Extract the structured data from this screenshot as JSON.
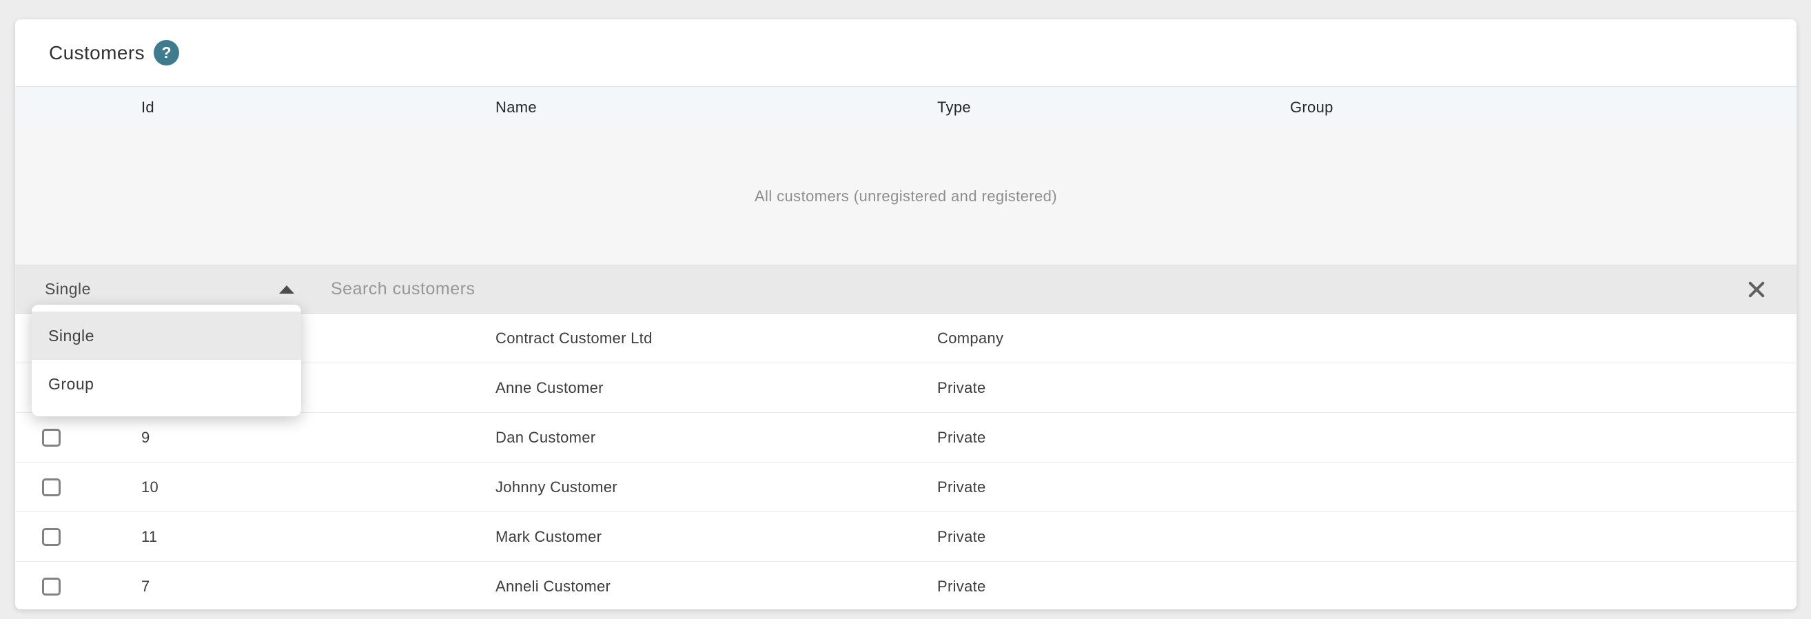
{
  "card": {
    "title": "Customers",
    "help_icon_glyph": "?"
  },
  "colors": {
    "accent_teal": "#3e7b8e",
    "header_row_bg": "#f3f7f9",
    "filter_bar_bg": "#e9e9e9",
    "page_bg": "#ededed"
  },
  "table": {
    "columns": {
      "id": "Id",
      "name": "Name",
      "type": "Type",
      "group": "Group"
    },
    "empty_state_text": "All customers (unregistered and registered)",
    "rows": [
      {
        "id": "",
        "name": "Contract Customer Ltd",
        "type": "Company",
        "group": ""
      },
      {
        "id": "",
        "name": "Anne Customer",
        "type": "Private",
        "group": ""
      },
      {
        "id": "9",
        "name": "Dan Customer",
        "type": "Private",
        "group": ""
      },
      {
        "id": "10",
        "name": "Johnny Customer",
        "type": "Private",
        "group": ""
      },
      {
        "id": "11",
        "name": "Mark Customer",
        "type": "Private",
        "group": ""
      },
      {
        "id": "7",
        "name": "Anneli Customer",
        "type": "Private",
        "group": ""
      }
    ]
  },
  "filter": {
    "type_select": {
      "value": "Single",
      "open": true,
      "options": [
        "Single",
        "Group"
      ],
      "highlighted_option": "Single"
    },
    "search": {
      "placeholder": "Search customers",
      "value": ""
    }
  }
}
